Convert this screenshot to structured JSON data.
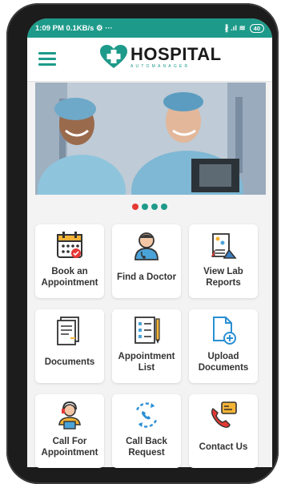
{
  "status_bar": {
    "time": "1:09 PM",
    "speed": "0.1KB/s",
    "extra": "⚙ ···",
    "signal": "∦ .ıl ≋",
    "battery": "40"
  },
  "header": {
    "logo_title": "HOSPITAL",
    "logo_subtitle": "AUTOMANAGER",
    "accent_color": "#1e9a8a"
  },
  "carousel": {
    "dot_count": 4,
    "active_index": 0
  },
  "tiles": [
    {
      "name": "book-appointment",
      "icon": "calendar-icon",
      "label": "Book an Appointment"
    },
    {
      "name": "find-doctor",
      "icon": "doctor-icon",
      "label": "Find a Doctor"
    },
    {
      "name": "view-lab-reports",
      "icon": "lab-icon",
      "label": "View Lab Reports"
    },
    {
      "name": "documents",
      "icon": "documents-icon",
      "label": "Documents"
    },
    {
      "name": "appointment-list",
      "icon": "checklist-icon",
      "label": "Appointment List"
    },
    {
      "name": "upload-documents",
      "icon": "upload-file-icon",
      "label": "Upload Documents"
    },
    {
      "name": "call-for-appointment",
      "icon": "call-agent-icon",
      "label": "Call For Appointment"
    },
    {
      "name": "call-back-request",
      "icon": "callback-icon",
      "label": "Call Back Request"
    },
    {
      "name": "contact-us",
      "icon": "contact-phone-icon",
      "label": "Contact Us"
    }
  ]
}
